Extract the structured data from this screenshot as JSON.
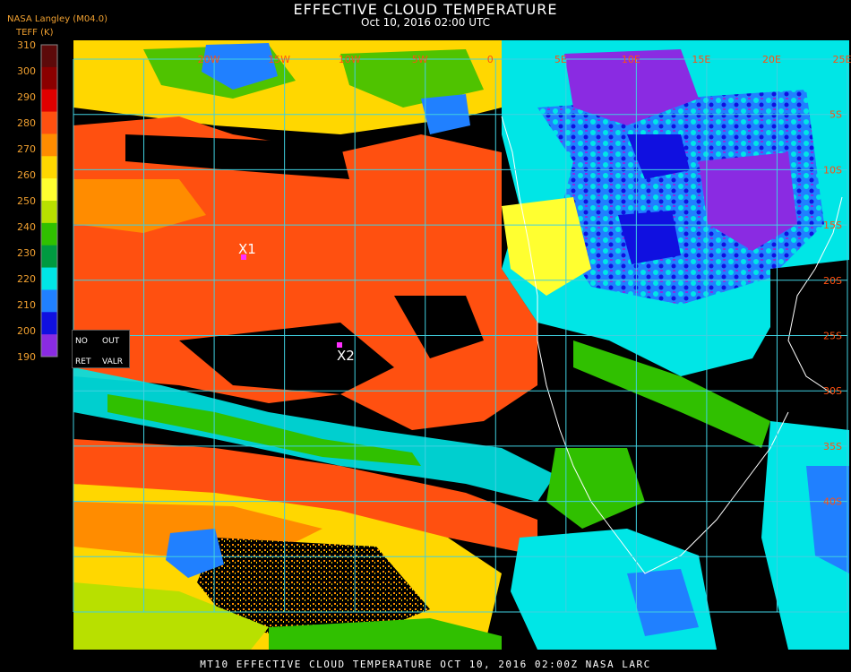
{
  "header": {
    "title": "EFFECTIVE CLOUD TEMPERATURE",
    "subtitle": "Oct 10, 2016 02:00 UTC",
    "producer": "NASA Langley (M04.0)",
    "units": "TEFF (K)"
  },
  "legend": {
    "ticks": [
      "310",
      "300",
      "290",
      "280",
      "270",
      "260",
      "250",
      "240",
      "230",
      "220",
      "210",
      "200",
      "190"
    ],
    "colors": [
      "#5c0a0a",
      "#8b0000",
      "#e00000",
      "#ff5010",
      "#ff8c00",
      "#ffd700",
      "#ffff30",
      "#b8e000",
      "#30c000",
      "#009a40",
      "#00e6e6",
      "#2080ff",
      "#1010e0",
      "#8a2be2"
    ],
    "no_ret_label": "NO",
    "ret_label": "RET",
    "out_label": "OUT",
    "valr_label": "VALR"
  },
  "map": {
    "lon_labels": [
      "20W",
      "15W",
      "10W",
      "5W",
      "0",
      "5E",
      "10E",
      "15E",
      "20E",
      "25E"
    ],
    "lat_labels": [
      "5S",
      "10S",
      "15S",
      "20S",
      "25S",
      "30S",
      "35S",
      "40S"
    ],
    "markers": [
      {
        "label": "X1",
        "color": "#ff2fff"
      },
      {
        "label": "X2",
        "color": "#ff2fff"
      }
    ],
    "grid_color": "#40d0e0",
    "palette": {
      "cold_deep": "#8a2be2",
      "cold_blue": "#1010e0",
      "mid_blue": "#2080ff",
      "cyan": "#00e6e6",
      "green": "#30c000",
      "yellow": "#ffff30",
      "gold": "#ffd700",
      "orange": "#ff8c00",
      "red_orange": "#ff5010",
      "clear": "#000000"
    }
  },
  "footer": {
    "text": "MT10  EFFECTIVE CLOUD TEMPERATURE   OCT 10, 2016 02:00Z   NASA LARC"
  }
}
